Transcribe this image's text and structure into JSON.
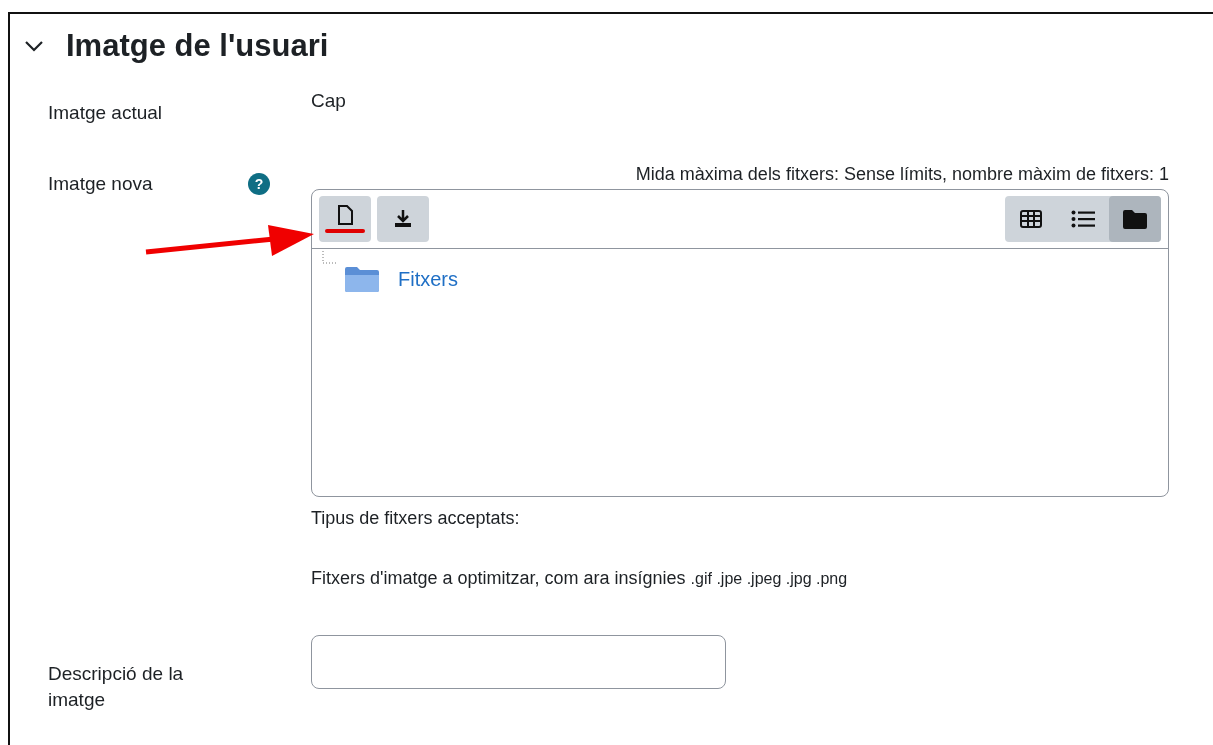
{
  "section": {
    "title": "Imatge de l'usuari",
    "expanded": true
  },
  "current_image": {
    "label": "Imatge actual",
    "value": "Cap"
  },
  "new_image": {
    "label": "Imatge nova",
    "help": "?",
    "limits": "Mida màxima dels fitxers: Sense límits, nombre màxim de fitxers: 1",
    "toolbar": [
      {
        "kind": "add-file",
        "highlighted": true
      },
      {
        "kind": "download",
        "highlighted": false
      }
    ],
    "view_modes": [
      {
        "kind": "grid",
        "selected": false
      },
      {
        "kind": "list",
        "selected": false
      },
      {
        "kind": "tree",
        "selected": true
      }
    ],
    "folders": [
      {
        "name": "Fitxers"
      }
    ],
    "accepted_title": "Tipus de fitxers acceptats:",
    "accepted_text": "Fitxers d'imatge a optimitzar, com ara insígnies",
    "accepted_ext": ".gif .jpe .jpeg .jpg .png"
  },
  "description": {
    "label": "Descripció de la imatge"
  }
}
